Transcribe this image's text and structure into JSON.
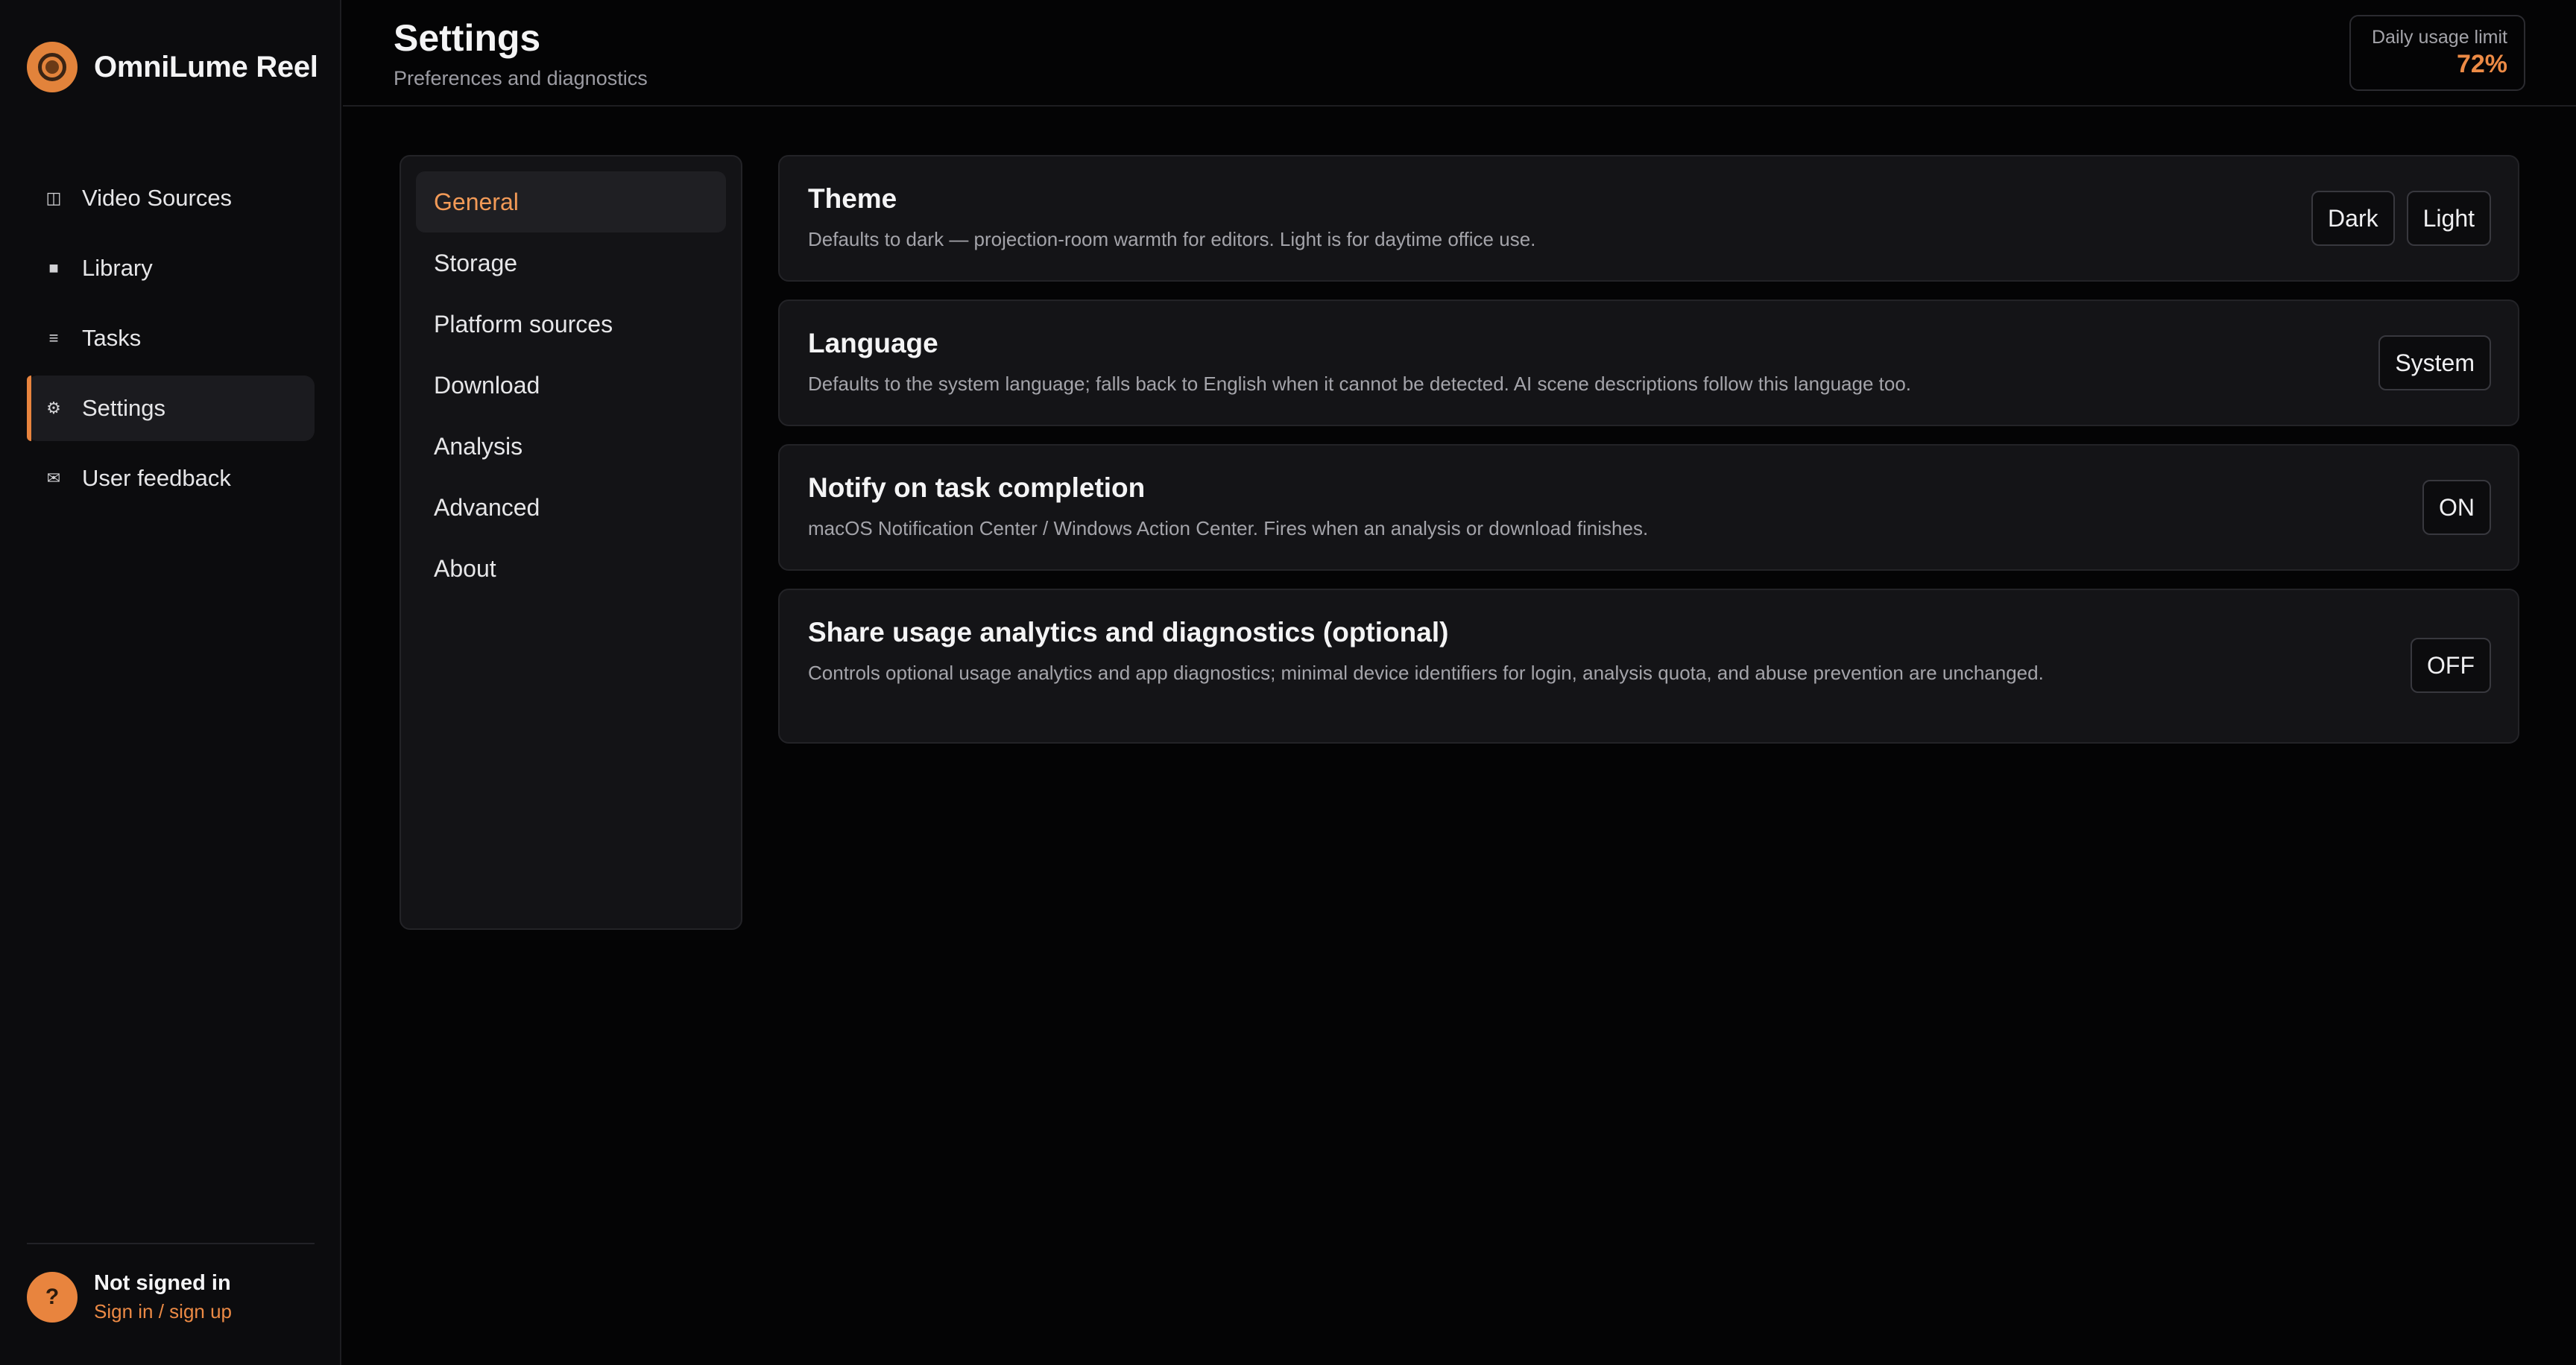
{
  "app": {
    "name": "OmniLume Reel"
  },
  "colors": {
    "accent": "#e8843e",
    "background": "#040405",
    "panel": "#141417"
  },
  "sidebar": {
    "items": [
      {
        "label": "Video Sources",
        "icon": "video-sources-icon",
        "glyph": "◫"
      },
      {
        "label": "Library",
        "icon": "library-icon",
        "glyph": "■"
      },
      {
        "label": "Tasks",
        "icon": "tasks-icon",
        "glyph": "≡"
      },
      {
        "label": "Settings",
        "icon": "gear-icon",
        "glyph": "⚙",
        "active": true
      },
      {
        "label": "User feedback",
        "icon": "mail-icon",
        "glyph": "✉"
      }
    ],
    "user": {
      "avatar_glyph": "?",
      "status": "Not signed in",
      "link": "Sign in / sign up"
    }
  },
  "header": {
    "title": "Settings",
    "subtitle": "Preferences and diagnostics",
    "usage": {
      "label": "Daily usage limit",
      "value": "72%"
    }
  },
  "settings_nav": {
    "selected": "General",
    "items": [
      "General",
      "Storage",
      "Platform sources",
      "Download",
      "Analysis",
      "Advanced",
      "About"
    ]
  },
  "cards": {
    "theme": {
      "title": "Theme",
      "description": "Defaults to dark — projection-room warmth for editors. Light is for daytime office use.",
      "options": [
        "Dark",
        "Light"
      ]
    },
    "language": {
      "title": "Language",
      "description": "Defaults to the system language; falls back to English when it cannot be detected. AI scene descriptions follow this language too.",
      "value": "System"
    },
    "notify": {
      "title": "Notify on task completion",
      "description": "macOS Notification Center / Windows Action Center. Fires when an analysis or download finishes.",
      "value": "ON"
    },
    "analytics": {
      "title": "Share usage analytics and diagnostics (optional)",
      "description": "Controls optional usage analytics and app diagnostics; minimal device identifiers for login, analysis quota, and abuse prevention are unchanged.",
      "value": "OFF"
    }
  }
}
